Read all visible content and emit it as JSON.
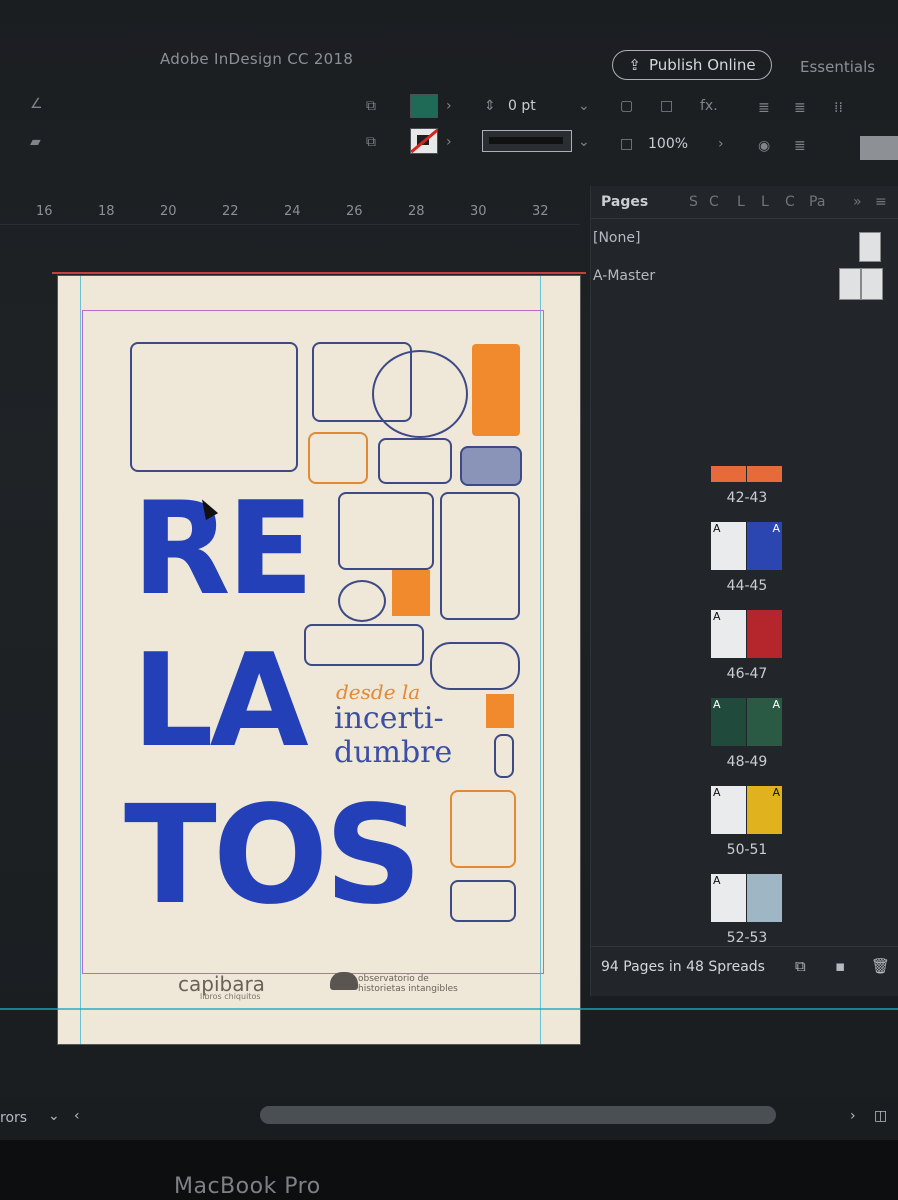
{
  "app": {
    "title": "Adobe InDesign CC 2018",
    "publish_label": "Publish Online",
    "workspace_label": "Essentials"
  },
  "control_bar": {
    "stroke_weight": "0 pt",
    "opacity": "100%",
    "fill_color": "#1f6a57",
    "fx_label": "fx."
  },
  "ruler": {
    "ticks": [
      "16",
      "18",
      "20",
      "22",
      "24",
      "26",
      "28",
      "30",
      "32"
    ]
  },
  "pages_panel": {
    "tabs": [
      "Pages",
      "S",
      "C",
      "L",
      "L",
      "C",
      "Pa"
    ],
    "masters": [
      "[None]",
      "A-Master"
    ],
    "spreads": [
      {
        "label": "42-43",
        "left_letter": "",
        "right_letter": "",
        "style": "orange-strip"
      },
      {
        "label": "44-45",
        "left_letter": "A",
        "right_letter": "A",
        "style": "blue"
      },
      {
        "label": "46-47",
        "left_letter": "A",
        "right_letter": "",
        "style": "red"
      },
      {
        "label": "48-49",
        "left_letter": "A",
        "right_letter": "A",
        "style": "green"
      },
      {
        "label": "50-51",
        "left_letter": "A",
        "right_letter": "A",
        "style": "yellow"
      },
      {
        "label": "52-53",
        "left_letter": "A",
        "right_letter": "",
        "style": "collage"
      }
    ],
    "footer": "94 Pages in 48 Spreads"
  },
  "document": {
    "title_lines": [
      "RE",
      "LA",
      "TOS"
    ],
    "subtitle_italic": "desde la",
    "subtitle_lines": [
      "incerti-",
      "dumbre"
    ],
    "logo1": "capibara",
    "logo1_sub": "libros chiquitos",
    "logo2_line1": "observatorio de",
    "logo2_line2": "historietas intangibles",
    "colors": {
      "blue": "#2340b8",
      "orange": "#f08a2c",
      "paper": "#efe8d8"
    }
  },
  "status": {
    "left_text": "rors"
  },
  "hardware": {
    "label": "MacBook Pro"
  }
}
